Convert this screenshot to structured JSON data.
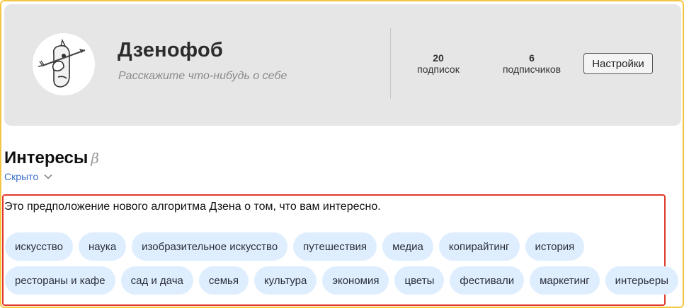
{
  "profile": {
    "name": "Дзенофоб",
    "about": "Расскажите что-нибудь о себе",
    "subscriptions": {
      "count": "20",
      "label": "подписок"
    },
    "followers": {
      "count": "6",
      "label": "подписчиков"
    },
    "settings_label": "Настройки"
  },
  "interests": {
    "title": "Интересы",
    "beta_mark": "β",
    "visibility_label": "Скрыто",
    "intro": "Это предположение нового алгоритма Дзена о том, что вам интересно.",
    "row1": [
      "искусство",
      "наука",
      "изобразительное искусство",
      "путешествия",
      "медиа",
      "копирайтинг",
      "история"
    ],
    "row2": [
      "рестораны и кафе",
      "сад и дача",
      "семья",
      "культура",
      "экономия",
      "цветы",
      "фестивали",
      "маркетинг",
      "интерьеры"
    ]
  },
  "colors": {
    "frame_border": "#f5c642",
    "highlight_border": "#e0392b",
    "tag_bg": "#dfeefe",
    "link": "#3b72c7"
  },
  "icons": {
    "avatar": "cartoon-face-arrow-icon",
    "visibility": "chevron-down-icon"
  }
}
